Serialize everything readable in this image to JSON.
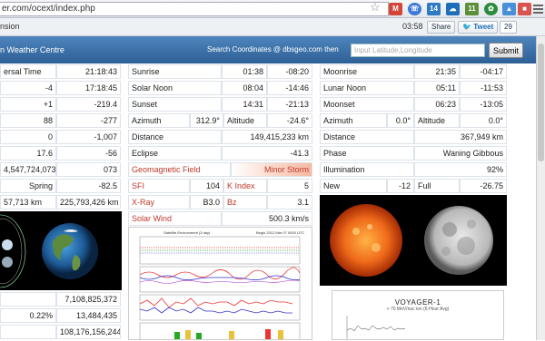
{
  "browser": {
    "url": "er.com/ocext/index.php",
    "extension_label": "nsion",
    "time": "03:58",
    "share_label": "Share",
    "tweet_label": "Tweet",
    "tweet_count": "29",
    "ext_badges": [
      "14",
      "11"
    ],
    "colors": {
      "gmail": "#d44638",
      "twitter_blue": "#1da1f2"
    }
  },
  "header": {
    "title": "n Weather Centre",
    "search_label": "Search Coordinates @ dbsgeo.com then",
    "search_placeholder": "Input Latitude,Longitude",
    "submit_label": "Submit"
  },
  "left_table": [
    [
      "ersal Time",
      "21:18:43"
    ],
    [
      "-4",
      "17:18:45"
    ],
    [
      "+1",
      "-219.4"
    ],
    [
      "88",
      "-277"
    ],
    [
      "0",
      "-1,007"
    ],
    [
      "17.6",
      "-56"
    ],
    [
      "4,547,724,073",
      "073"
    ],
    [
      "Spring",
      "-82.5"
    ],
    [
      "57,713 km",
      "225,793,426 km"
    ]
  ],
  "sun_rows": [
    {
      "label": "Sunrise",
      "a": "01:38",
      "b": "-08:20"
    },
    {
      "label": "Solar Noon",
      "a": "08:04",
      "b": "-14:46"
    },
    {
      "label": "Sunset",
      "a": "14:31",
      "b": "-21:13"
    }
  ],
  "azimuth": {
    "label": "Azimuth",
    "value": "312.9°",
    "alt_label": "Altitude",
    "alt_value": "-24.6°"
  },
  "distance": {
    "label": "Distance",
    "value": "149,415,233 km"
  },
  "eclipse": {
    "label": "Eclipse",
    "value": "-41.3"
  },
  "geomagnetic": {
    "label": "Geomagnetic Field",
    "value": "Minor Storm"
  },
  "sfi": {
    "label": "SFI",
    "value": "104",
    "k_label": "K Index",
    "k_value": "5"
  },
  "xray": {
    "label": "X-Ray",
    "value": "B3.0",
    "bz_label": "Bz",
    "bz_value": "3.1"
  },
  "solar_wind": {
    "label": "Solar Wind",
    "value": "500.3 km/s"
  },
  "moon_rows": [
    {
      "label": "Moonrise",
      "a": "21:35",
      "b": "-04:17"
    },
    {
      "label": "Lunar Noon",
      "a": "05:11",
      "b": "-11:53"
    },
    {
      "label": "Moonset",
      "a": "06:23",
      "b": "-13:05"
    }
  ],
  "moon_az": {
    "label": "Azimuth",
    "value": "0.0°",
    "alt_label": "Altitude",
    "alt_value": "0.0°"
  },
  "moon_distance": {
    "label": "Distance",
    "value": "367,949 km"
  },
  "phase": {
    "label": "Phase",
    "value": "Waning Gibbous"
  },
  "illumination": {
    "label": "Illumination",
    "value": "92%"
  },
  "new_full": {
    "new_label": "New",
    "new_value": "-12",
    "full_label": "Full",
    "full_value": "-26.75"
  },
  "bottom_left": [
    [
      "",
      "7,108,825,372"
    ],
    [
      "0.22%",
      "13,484,435"
    ],
    [
      "",
      "108,176,156,244"
    ]
  ],
  "graph": {
    "title": "Satellite Environment (3 day)",
    "begin": "Begin  2012 Mar 07 0000 UTC"
  },
  "voyager": {
    "title": "VOYAGER-1",
    "subtitle": "> 70 MeV/nuc ion (6-Hour Avg)"
  }
}
